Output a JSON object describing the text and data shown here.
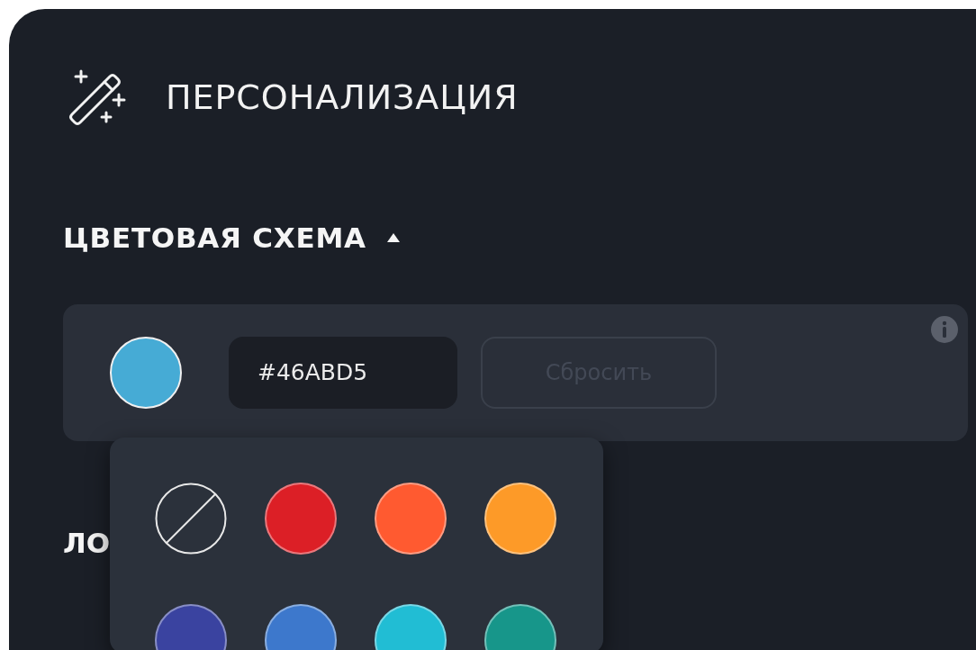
{
  "title": "ПЕРСОНАЛИЗАЦИЯ",
  "color_scheme": {
    "heading": "ЦВЕТОВАЯ СХЕМА",
    "expanded": true,
    "hex_value": "#46ABD5",
    "reset_button": {
      "label": "Сбросить",
      "disabled": true
    }
  },
  "next_heading": "ЛО",
  "palette": [
    {
      "kind": "none"
    },
    {
      "kind": "color",
      "color": "#dc1f26"
    },
    {
      "kind": "color",
      "color": "#ff5a30"
    },
    {
      "kind": "color",
      "color": "#fd9a28"
    },
    {
      "kind": "color",
      "color": "#3a43a0"
    },
    {
      "kind": "color",
      "color": "#3d78cc"
    },
    {
      "kind": "color",
      "color": "#21bdd4"
    },
    {
      "kind": "color",
      "color": "#17968a"
    }
  ]
}
